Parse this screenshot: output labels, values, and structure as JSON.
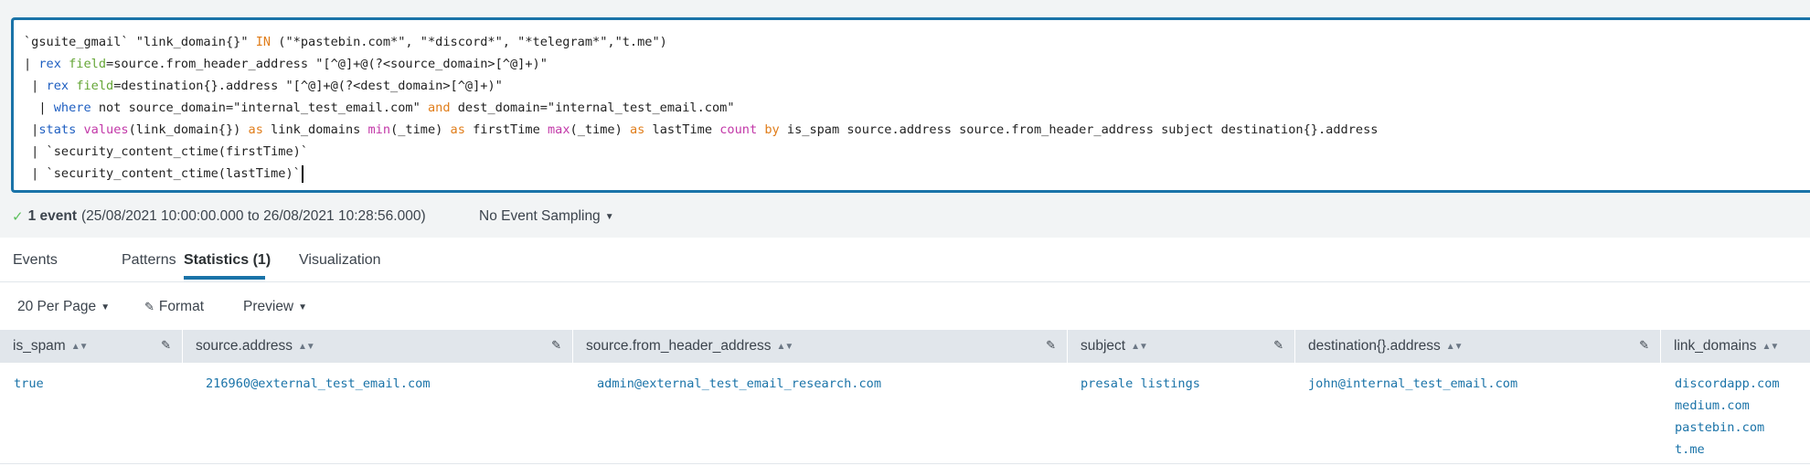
{
  "search": {
    "lines": [
      [
        {
          "t": "`gsuite_gmail` \"link_domain{}\" ",
          "c": "k-macro"
        },
        {
          "t": "IN",
          "c": "k-op"
        },
        {
          "t": " (\"*pastebin.com*\", \"*discord*\", \"*telegram*\",\"t.me\")",
          "c": "k-macro"
        }
      ],
      [
        {
          "t": "| ",
          "c": "k-macro"
        },
        {
          "t": "rex",
          "c": "k-cmd"
        },
        {
          "t": " ",
          "c": "k-macro"
        },
        {
          "t": "field",
          "c": "k-arg"
        },
        {
          "t": "=source.from_header_address \"[^@]+@(?<source_domain>[^@]+)\"",
          "c": "k-macro"
        }
      ],
      [
        {
          "t": " | ",
          "c": "k-macro"
        },
        {
          "t": "rex",
          "c": "k-cmd"
        },
        {
          "t": " ",
          "c": "k-macro"
        },
        {
          "t": "field",
          "c": "k-arg"
        },
        {
          "t": "=destination{}.address \"[^@]+@(?<dest_domain>[^@]+)\"",
          "c": "k-macro"
        }
      ],
      [
        {
          "t": "  | ",
          "c": "k-macro"
        },
        {
          "t": "where",
          "c": "k-cmd"
        },
        {
          "t": " not source_domain=\"internal_test_email.com\" ",
          "c": "k-macro"
        },
        {
          "t": "and",
          "c": "k-op"
        },
        {
          "t": " dest_domain=\"internal_test_email.com\"",
          "c": "k-macro"
        }
      ],
      [
        {
          "t": " |",
          "c": "k-macro"
        },
        {
          "t": "stats",
          "c": "k-cmd"
        },
        {
          "t": " ",
          "c": "k-macro"
        },
        {
          "t": "values",
          "c": "k-fn"
        },
        {
          "t": "(link_domain{}) ",
          "c": "k-macro"
        },
        {
          "t": "as",
          "c": "k-op"
        },
        {
          "t": " link_domains ",
          "c": "k-macro"
        },
        {
          "t": "min",
          "c": "k-fn"
        },
        {
          "t": "(_time) ",
          "c": "k-macro"
        },
        {
          "t": "as",
          "c": "k-op"
        },
        {
          "t": " firstTime ",
          "c": "k-macro"
        },
        {
          "t": "max",
          "c": "k-fn"
        },
        {
          "t": "(_time) ",
          "c": "k-macro"
        },
        {
          "t": "as",
          "c": "k-op"
        },
        {
          "t": " lastTime ",
          "c": "k-macro"
        },
        {
          "t": "count",
          "c": "k-fn"
        },
        {
          "t": " ",
          "c": "k-macro"
        },
        {
          "t": "by",
          "c": "k-op"
        },
        {
          "t": " is_spam source.address source.from_header_address subject destination{}.address",
          "c": "k-macro"
        }
      ],
      [
        {
          "t": " | `security_content_ctime(firstTime)`",
          "c": "k-macro"
        }
      ],
      [
        {
          "t": " | `security_content_ctime(lastTime)`",
          "c": "k-macro"
        }
      ]
    ]
  },
  "status": {
    "check_icon": "checkmark-icon",
    "count": "1 event",
    "range": "(25/08/2021 10:00:00.000 to 26/08/2021 10:28:56.000)",
    "sampling": "No Event Sampling"
  },
  "tabs": [
    "Events",
    "Patterns",
    "Statistics (1)",
    "Visualization"
  ],
  "active_tab": "Statistics (1)",
  "toolbar": {
    "per_page": "20 Per Page",
    "format": "Format",
    "preview": "Preview"
  },
  "table": {
    "columns": [
      "is_spam",
      "source.address",
      "source.from_header_address",
      "subject",
      "destination{}.address",
      "link_domains"
    ],
    "rows": [
      {
        "is_spam": "true",
        "source_address": "216960@external_test_email.com",
        "from_header_address": "admin@external_test_email_research.com",
        "subject": "presale listings",
        "destination_address": "john@internal_test_email.com",
        "link_domains": [
          "discordapp.com",
          "medium.com",
          "pastebin.com",
          "t.me"
        ]
      }
    ]
  },
  "colors": {
    "accent": "#1a73a8",
    "operator": "#e07d1a",
    "command": "#1f5fc1",
    "argument": "#65a637",
    "function": "#c238a8"
  }
}
